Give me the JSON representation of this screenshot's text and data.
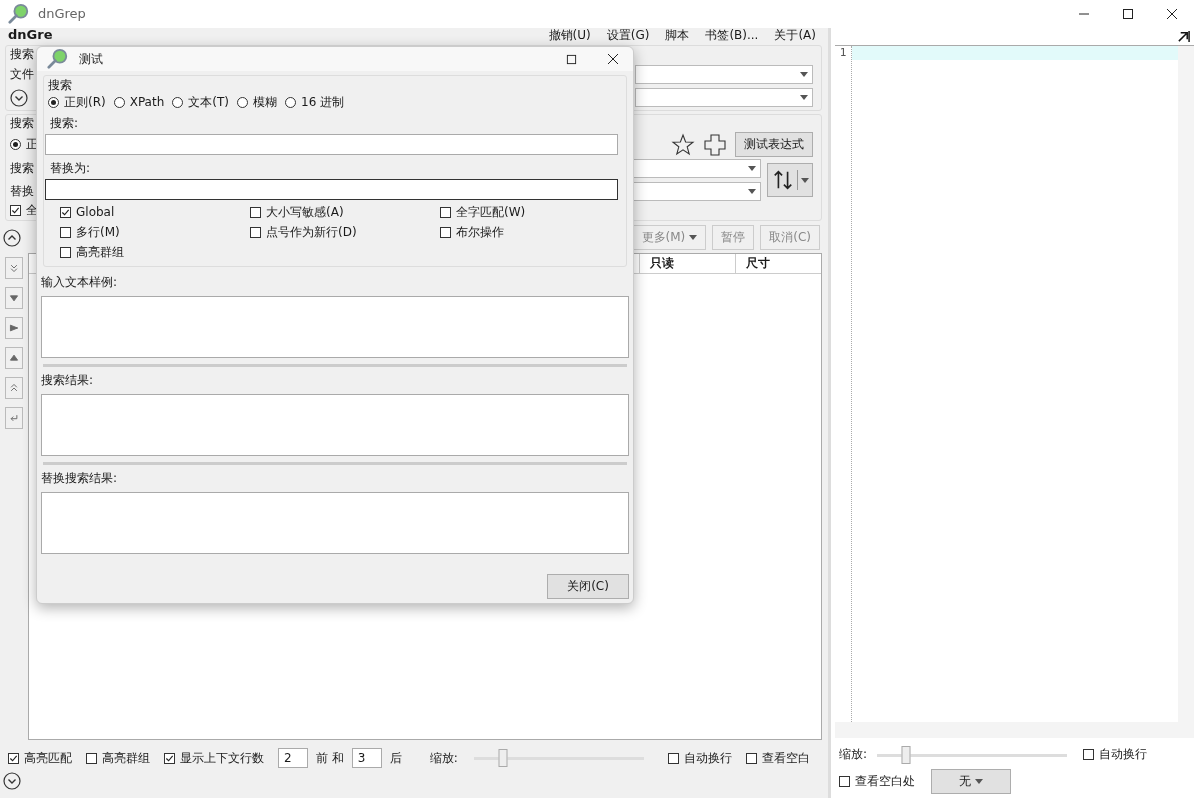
{
  "window": {
    "title": "dnGrep"
  },
  "main": {
    "heading": "dnGre",
    "menu": [
      {
        "label": "撤销(U)"
      },
      {
        "label": "设置(G)"
      },
      {
        "label": "脚本"
      },
      {
        "label": "书签(B)..."
      },
      {
        "label": "关于(A)"
      }
    ],
    "files_section": {
      "label": "搜索",
      "file_label": "文件"
    },
    "search_section": {
      "label": "搜索",
      "radio": {
        "label": "正",
        "selected": true
      },
      "search_label": "搜索",
      "replace_label": "替换",
      "checkbox": {
        "label": "全",
        "checked": true
      },
      "test_button": "测试表达式"
    },
    "actions": [
      {
        "label": "更多(M)",
        "dropdown": true
      },
      {
        "label": "暂停",
        "dropdown": false
      },
      {
        "label": "取消(C)",
        "dropdown": false
      }
    ],
    "results_table": {
      "columns": [
        "只读",
        "尺寸"
      ]
    },
    "bottom_bar": [
      {
        "kind": "checkbox",
        "label": "高亮匹配",
        "checked": true
      },
      {
        "kind": "checkbox",
        "label": "高亮群组",
        "checked": false
      },
      {
        "kind": "checkbox",
        "label": "显示上下文行数",
        "checked": true
      },
      {
        "kind": "input",
        "value": "2"
      },
      {
        "kind": "text",
        "label": "前 和"
      },
      {
        "kind": "input",
        "value": "3"
      },
      {
        "kind": "text",
        "label": "后"
      },
      {
        "kind": "slider",
        "label": "缩放:",
        "level": 0.17
      },
      {
        "kind": "checkbox",
        "label": "自动换行",
        "checked": false
      },
      {
        "kind": "checkbox",
        "label": "查看空白",
        "checked": false
      }
    ]
  },
  "editor": {
    "line_numbers": [
      "1"
    ],
    "zoom_label": "缩放:",
    "zoom": {
      "level": 0.15
    },
    "word_wrap": {
      "label": "自动换行",
      "checked": false
    },
    "show_whitespace": {
      "label": "查看空白处",
      "checked": false
    },
    "dropdown": "无"
  },
  "dialog": {
    "title": "测试",
    "mode_group": "搜索",
    "modes": [
      {
        "label": "正则(R)",
        "selected": true
      },
      {
        "label": "XPath",
        "selected": false
      },
      {
        "label": "文本(T)",
        "selected": false
      },
      {
        "label": "模糊",
        "selected": false
      },
      {
        "label": "16 进制",
        "selected": false
      }
    ],
    "search_label": "搜索:",
    "replace_label": "替换为:",
    "options": [
      {
        "label": "Global",
        "checked": true
      },
      {
        "label": "大小写敏感(A)",
        "checked": false
      },
      {
        "label": "全字匹配(W)",
        "checked": false
      },
      {
        "label": "多行(M)",
        "checked": false
      },
      {
        "label": "点号作为新行(D)",
        "checked": false
      },
      {
        "label": "布尔操作",
        "checked": false
      },
      {
        "label": "高亮群组",
        "checked": false
      }
    ],
    "sample_label": "输入文本样例:",
    "result_label": "搜索结果:",
    "replace_result_label": "替换搜索结果:",
    "close_button": "关闭(C)"
  }
}
